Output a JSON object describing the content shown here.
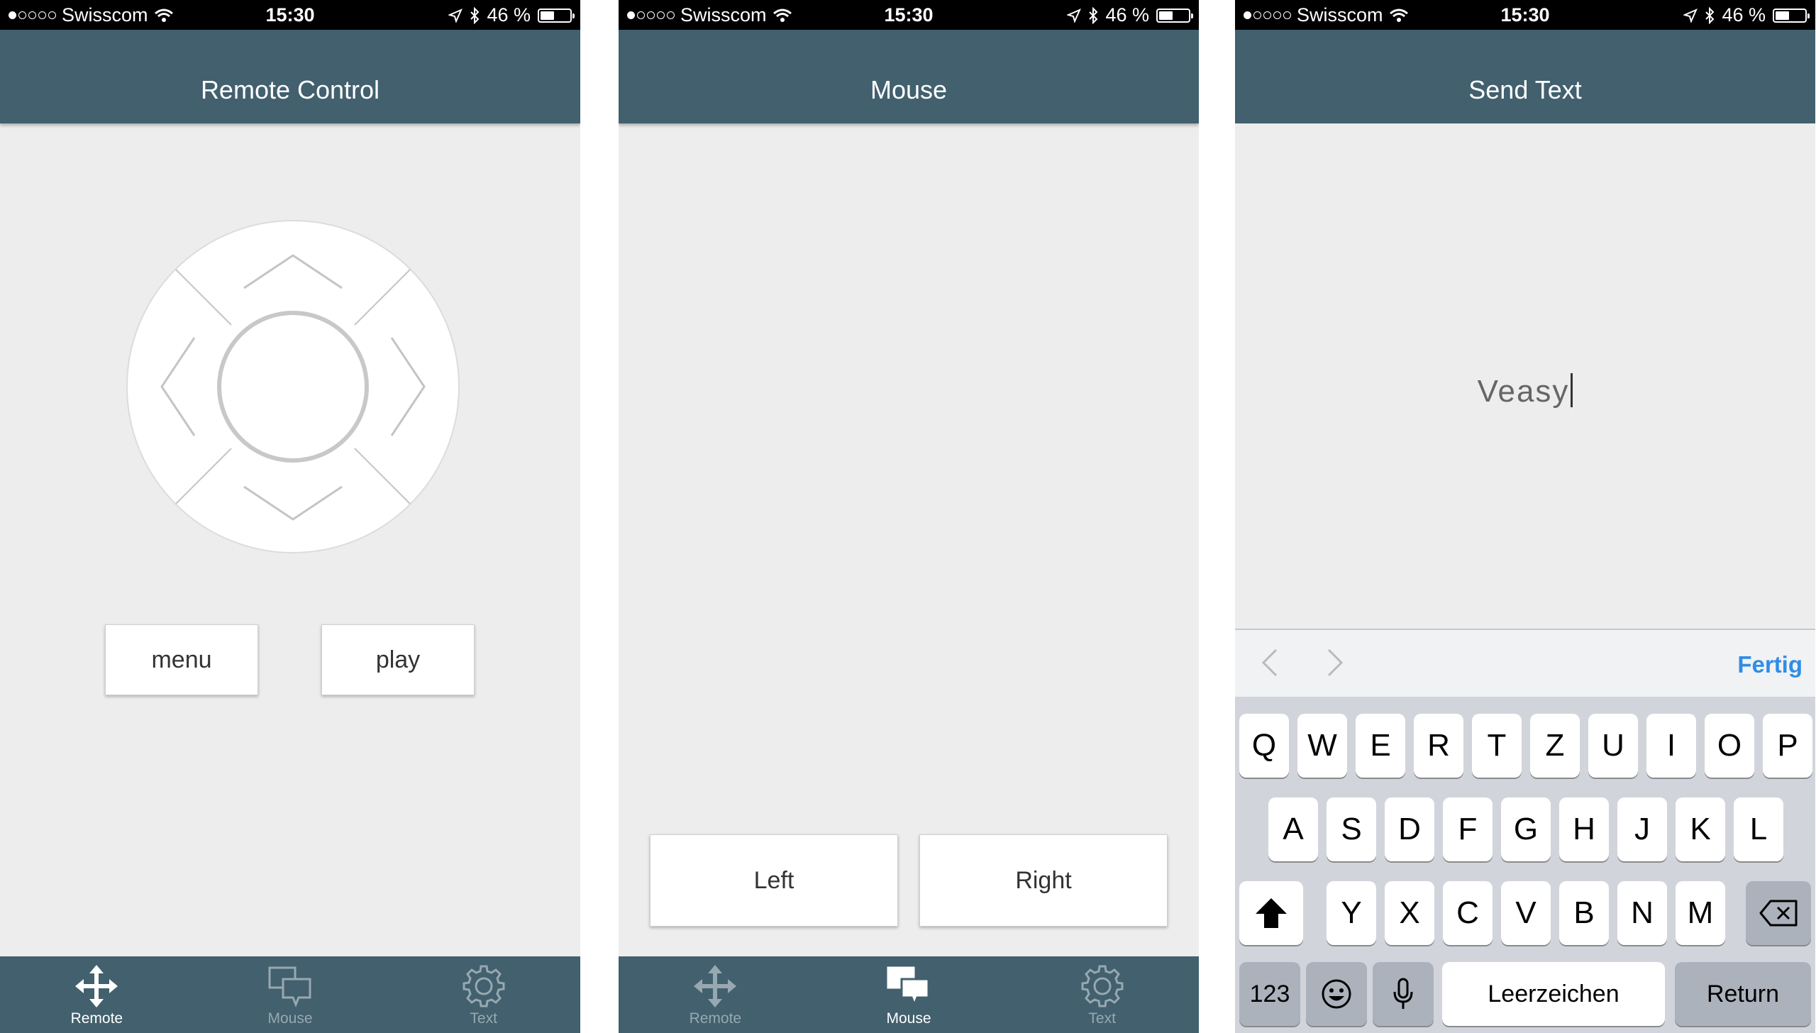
{
  "status_bar": {
    "carrier": "Swisscom",
    "time": "15:30",
    "battery": "46 %",
    "battery_level": 0.46
  },
  "screens": {
    "remote": {
      "title": "Remote Control",
      "menu_label": "menu",
      "play_label": "play"
    },
    "mouse": {
      "title": "Mouse",
      "left_label": "Left",
      "right_label": "Right"
    },
    "text": {
      "title": "Send Text",
      "typed_text": "Veasy",
      "done_label": "Fertig",
      "keyboard": {
        "row1": [
          "Q",
          "W",
          "E",
          "R",
          "T",
          "Z",
          "U",
          "I",
          "O",
          "P"
        ],
        "row2": [
          "A",
          "S",
          "D",
          "F",
          "G",
          "H",
          "J",
          "K",
          "L"
        ],
        "row3": [
          "Y",
          "X",
          "C",
          "V",
          "B",
          "N",
          "M"
        ],
        "numbers_label": "123",
        "space_label": "Leerzeichen",
        "return_label": "Return"
      }
    }
  },
  "tabs": {
    "remote": "Remote",
    "mouse": "Mouse",
    "text": "Text"
  },
  "colors": {
    "nav": "#42606e",
    "tab_inactive": "#98a8b0",
    "accent": "#2f8de6"
  },
  "icons": [
    "wifi-icon",
    "location-icon",
    "bluetooth-icon",
    "battery-icon",
    "move-icon",
    "chat-icon",
    "gear-icon",
    "shift-icon",
    "backspace-icon",
    "emoji-icon",
    "microphone-icon",
    "chevron-left-icon",
    "chevron-right-icon"
  ]
}
